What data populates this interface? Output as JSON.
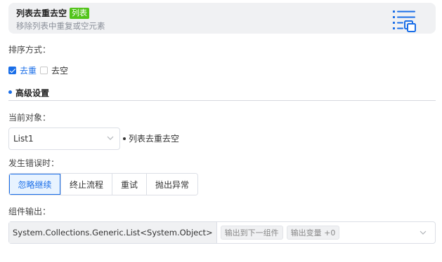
{
  "header": {
    "title": "列表去重去空",
    "tag": "列表",
    "subtitle": "移除列表中重复或空元素",
    "icon": "list-dedupe-icon"
  },
  "sort": {
    "label": "排序方式：",
    "options": [
      {
        "label": "去重",
        "checked": true
      },
      {
        "label": "去空",
        "checked": false
      }
    ]
  },
  "advanced": {
    "title": "高级设置"
  },
  "target": {
    "label": "当前对象：",
    "value": "List1",
    "note": "列表去重去空"
  },
  "error": {
    "label": "发生错误时：",
    "options": [
      "忽略继续",
      "终止流程",
      "重试",
      "抛出异常"
    ],
    "selected": "忽略继续"
  },
  "output": {
    "label": "组件输出：",
    "type": "System.Collections.Generic.List<System.Object>",
    "chip_next": "输出到下一组件",
    "chip_var": "输出变量 +0"
  },
  "colors": {
    "accent": "#1a6ee8",
    "tag": "#52c41a"
  }
}
